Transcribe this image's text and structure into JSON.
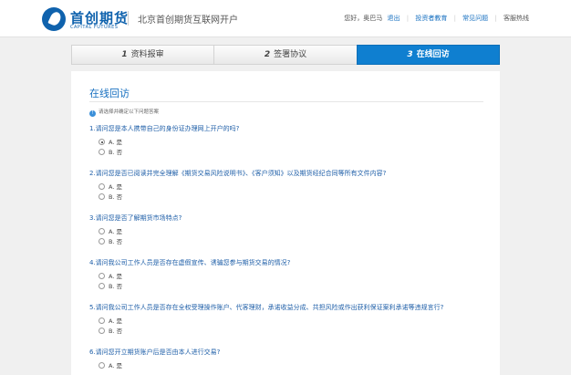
{
  "header": {
    "logo_cn": "首创期货",
    "logo_en": "CAPITAL FUTURES",
    "site_title": "北京首创期货互联网开户",
    "greeting": "您好，奥巴马",
    "logout": "退出",
    "nav_investor_education": "投资者教育",
    "nav_faq": "常见问题",
    "nav_hotline": "客服热线"
  },
  "steps": [
    {
      "num": "1",
      "label": "资料报审",
      "active": false
    },
    {
      "num": "2",
      "label": "签署协议",
      "active": false
    },
    {
      "num": "3",
      "label": "在线回访",
      "active": true
    }
  ],
  "card": {
    "title": "在线回访",
    "hint": "请选择并确定以下问题答案"
  },
  "questions": [
    {
      "text": "1.请问您是本人携带自己的身份证办理网上开户的吗?",
      "options": [
        {
          "label": "A. 是",
          "checked": true
        },
        {
          "label": "B. 否",
          "checked": false
        }
      ]
    },
    {
      "text": "2.请问您是否已阅读并完全理解《期货交易风险说明书》、《客户须知》以及期货经纪合同等所有文件内容?",
      "options": [
        {
          "label": "A. 是",
          "checked": false
        },
        {
          "label": "B. 否",
          "checked": false
        }
      ]
    },
    {
      "text": "3.请问您是否了解期货市场特点?",
      "options": [
        {
          "label": "A. 是",
          "checked": false
        },
        {
          "label": "B. 否",
          "checked": false
        }
      ]
    },
    {
      "text": "4.请问我公司工作人员是否存在虚假宣传、诱骗您参与期货交易的情况?",
      "options": [
        {
          "label": "A. 是",
          "checked": false
        },
        {
          "label": "B. 否",
          "checked": false
        }
      ]
    },
    {
      "text": "5.请问我公司工作人员是否存在全权受理操作账户、代客理财，承诺收益分成、共担风险或作出获利保证案利承诺等违规言行?",
      "options": [
        {
          "label": "A. 是",
          "checked": false
        },
        {
          "label": "B. 否",
          "checked": false
        }
      ]
    },
    {
      "text": "6.请问您开立期货账户后是否由本人进行交易?",
      "options": [
        {
          "label": "A. 是",
          "checked": false
        }
      ]
    }
  ]
}
